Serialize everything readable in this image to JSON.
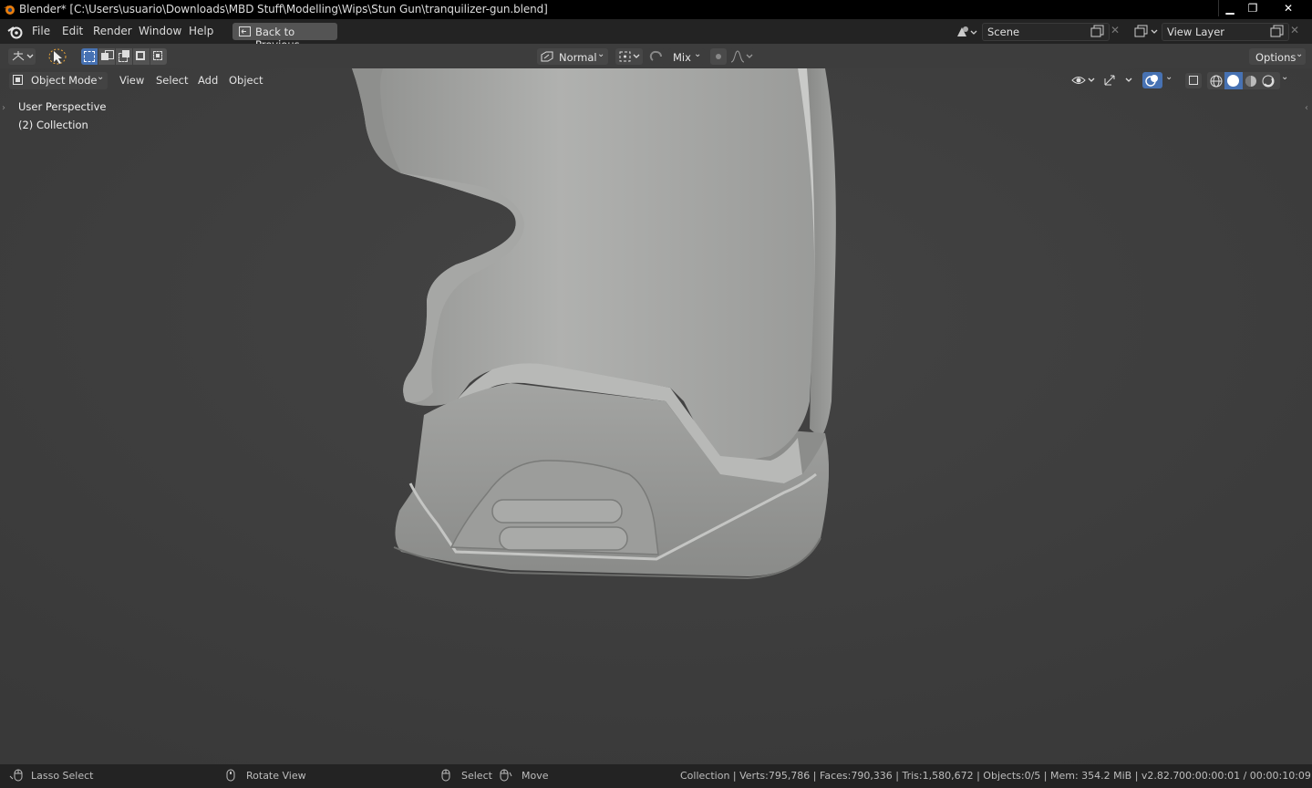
{
  "window": {
    "title": "Blender* [C:\\Users\\usuario\\Downloads\\MBD Stuff\\Modelling\\Wips\\Stun Gun\\tranquilizer-gun.blend]",
    "minimize_glyph": "▁",
    "maximize_glyph": "❐",
    "close_glyph": "✕"
  },
  "topbar": {
    "menus": [
      "File",
      "Edit",
      "Render",
      "Window",
      "Help"
    ],
    "back_button_label": "Back to Previous",
    "scene_name": "Scene",
    "view_layer_name": "View Layer"
  },
  "tool_header": {
    "orientation": "Normal",
    "proportional_falloff_mode": "Mix",
    "options_label": "Options"
  },
  "viewport": {
    "mode": "Object Mode",
    "menus": [
      "View",
      "Select",
      "Add",
      "Object"
    ],
    "overlay_text": {
      "perspective": "User Perspective",
      "collection": "(2) Collection"
    },
    "shading_active": "solid"
  },
  "statusbar": {
    "left_hint": "Lasso Select",
    "middle_hint": "Rotate View",
    "right_hint_select": "Select",
    "right_hint_move": "Move",
    "stats": "Collection | Verts:795,786 | Faces:790,336 | Tris:1,580,672 | Objects:0/5 | Mem: 354.2 MiB | v2.82.7",
    "time": "00:00:00:01 / 00:00:10:09"
  },
  "colors": {
    "accent_blue": "#4772b3",
    "viewport_bg": "#3c3c3c",
    "mesh_gray": "#9a9b99",
    "logo_orange": "#e87d0d"
  }
}
